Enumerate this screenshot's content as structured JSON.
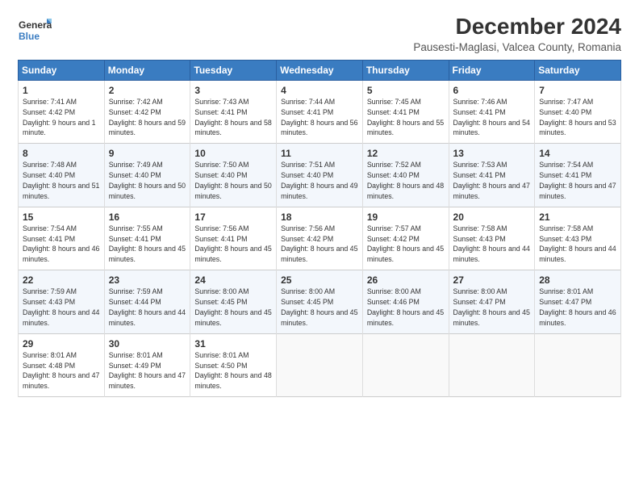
{
  "header": {
    "logo_line1": "General",
    "logo_line2": "Blue",
    "title": "December 2024",
    "subtitle": "Pausesti-Maglasi, Valcea County, Romania"
  },
  "days_of_week": [
    "Sunday",
    "Monday",
    "Tuesday",
    "Wednesday",
    "Thursday",
    "Friday",
    "Saturday"
  ],
  "weeks": [
    [
      {
        "day": 1,
        "sunrise": "7:41 AM",
        "sunset": "4:42 PM",
        "daylight": "9 hours and 1 minute."
      },
      {
        "day": 2,
        "sunrise": "7:42 AM",
        "sunset": "4:42 PM",
        "daylight": "8 hours and 59 minutes."
      },
      {
        "day": 3,
        "sunrise": "7:43 AM",
        "sunset": "4:41 PM",
        "daylight": "8 hours and 58 minutes."
      },
      {
        "day": 4,
        "sunrise": "7:44 AM",
        "sunset": "4:41 PM",
        "daylight": "8 hours and 56 minutes."
      },
      {
        "day": 5,
        "sunrise": "7:45 AM",
        "sunset": "4:41 PM",
        "daylight": "8 hours and 55 minutes."
      },
      {
        "day": 6,
        "sunrise": "7:46 AM",
        "sunset": "4:41 PM",
        "daylight": "8 hours and 54 minutes."
      },
      {
        "day": 7,
        "sunrise": "7:47 AM",
        "sunset": "4:40 PM",
        "daylight": "8 hours and 53 minutes."
      }
    ],
    [
      {
        "day": 8,
        "sunrise": "7:48 AM",
        "sunset": "4:40 PM",
        "daylight": "8 hours and 51 minutes."
      },
      {
        "day": 9,
        "sunrise": "7:49 AM",
        "sunset": "4:40 PM",
        "daylight": "8 hours and 50 minutes."
      },
      {
        "day": 10,
        "sunrise": "7:50 AM",
        "sunset": "4:40 PM",
        "daylight": "8 hours and 50 minutes."
      },
      {
        "day": 11,
        "sunrise": "7:51 AM",
        "sunset": "4:40 PM",
        "daylight": "8 hours and 49 minutes."
      },
      {
        "day": 12,
        "sunrise": "7:52 AM",
        "sunset": "4:40 PM",
        "daylight": "8 hours and 48 minutes."
      },
      {
        "day": 13,
        "sunrise": "7:53 AM",
        "sunset": "4:41 PM",
        "daylight": "8 hours and 47 minutes."
      },
      {
        "day": 14,
        "sunrise": "7:54 AM",
        "sunset": "4:41 PM",
        "daylight": "8 hours and 47 minutes."
      }
    ],
    [
      {
        "day": 15,
        "sunrise": "7:54 AM",
        "sunset": "4:41 PM",
        "daylight": "8 hours and 46 minutes."
      },
      {
        "day": 16,
        "sunrise": "7:55 AM",
        "sunset": "4:41 PM",
        "daylight": "8 hours and 45 minutes."
      },
      {
        "day": 17,
        "sunrise": "7:56 AM",
        "sunset": "4:41 PM",
        "daylight": "8 hours and 45 minutes."
      },
      {
        "day": 18,
        "sunrise": "7:56 AM",
        "sunset": "4:42 PM",
        "daylight": "8 hours and 45 minutes."
      },
      {
        "day": 19,
        "sunrise": "7:57 AM",
        "sunset": "4:42 PM",
        "daylight": "8 hours and 45 minutes."
      },
      {
        "day": 20,
        "sunrise": "7:58 AM",
        "sunset": "4:43 PM",
        "daylight": "8 hours and 44 minutes."
      },
      {
        "day": 21,
        "sunrise": "7:58 AM",
        "sunset": "4:43 PM",
        "daylight": "8 hours and 44 minutes."
      }
    ],
    [
      {
        "day": 22,
        "sunrise": "7:59 AM",
        "sunset": "4:43 PM",
        "daylight": "8 hours and 44 minutes."
      },
      {
        "day": 23,
        "sunrise": "7:59 AM",
        "sunset": "4:44 PM",
        "daylight": "8 hours and 44 minutes."
      },
      {
        "day": 24,
        "sunrise": "8:00 AM",
        "sunset": "4:45 PM",
        "daylight": "8 hours and 45 minutes."
      },
      {
        "day": 25,
        "sunrise": "8:00 AM",
        "sunset": "4:45 PM",
        "daylight": "8 hours and 45 minutes."
      },
      {
        "day": 26,
        "sunrise": "8:00 AM",
        "sunset": "4:46 PM",
        "daylight": "8 hours and 45 minutes."
      },
      {
        "day": 27,
        "sunrise": "8:00 AM",
        "sunset": "4:47 PM",
        "daylight": "8 hours and 45 minutes."
      },
      {
        "day": 28,
        "sunrise": "8:01 AM",
        "sunset": "4:47 PM",
        "daylight": "8 hours and 46 minutes."
      }
    ],
    [
      {
        "day": 29,
        "sunrise": "8:01 AM",
        "sunset": "4:48 PM",
        "daylight": "8 hours and 47 minutes."
      },
      {
        "day": 30,
        "sunrise": "8:01 AM",
        "sunset": "4:49 PM",
        "daylight": "8 hours and 47 minutes."
      },
      {
        "day": 31,
        "sunrise": "8:01 AM",
        "sunset": "4:50 PM",
        "daylight": "8 hours and 48 minutes."
      },
      null,
      null,
      null,
      null
    ]
  ]
}
